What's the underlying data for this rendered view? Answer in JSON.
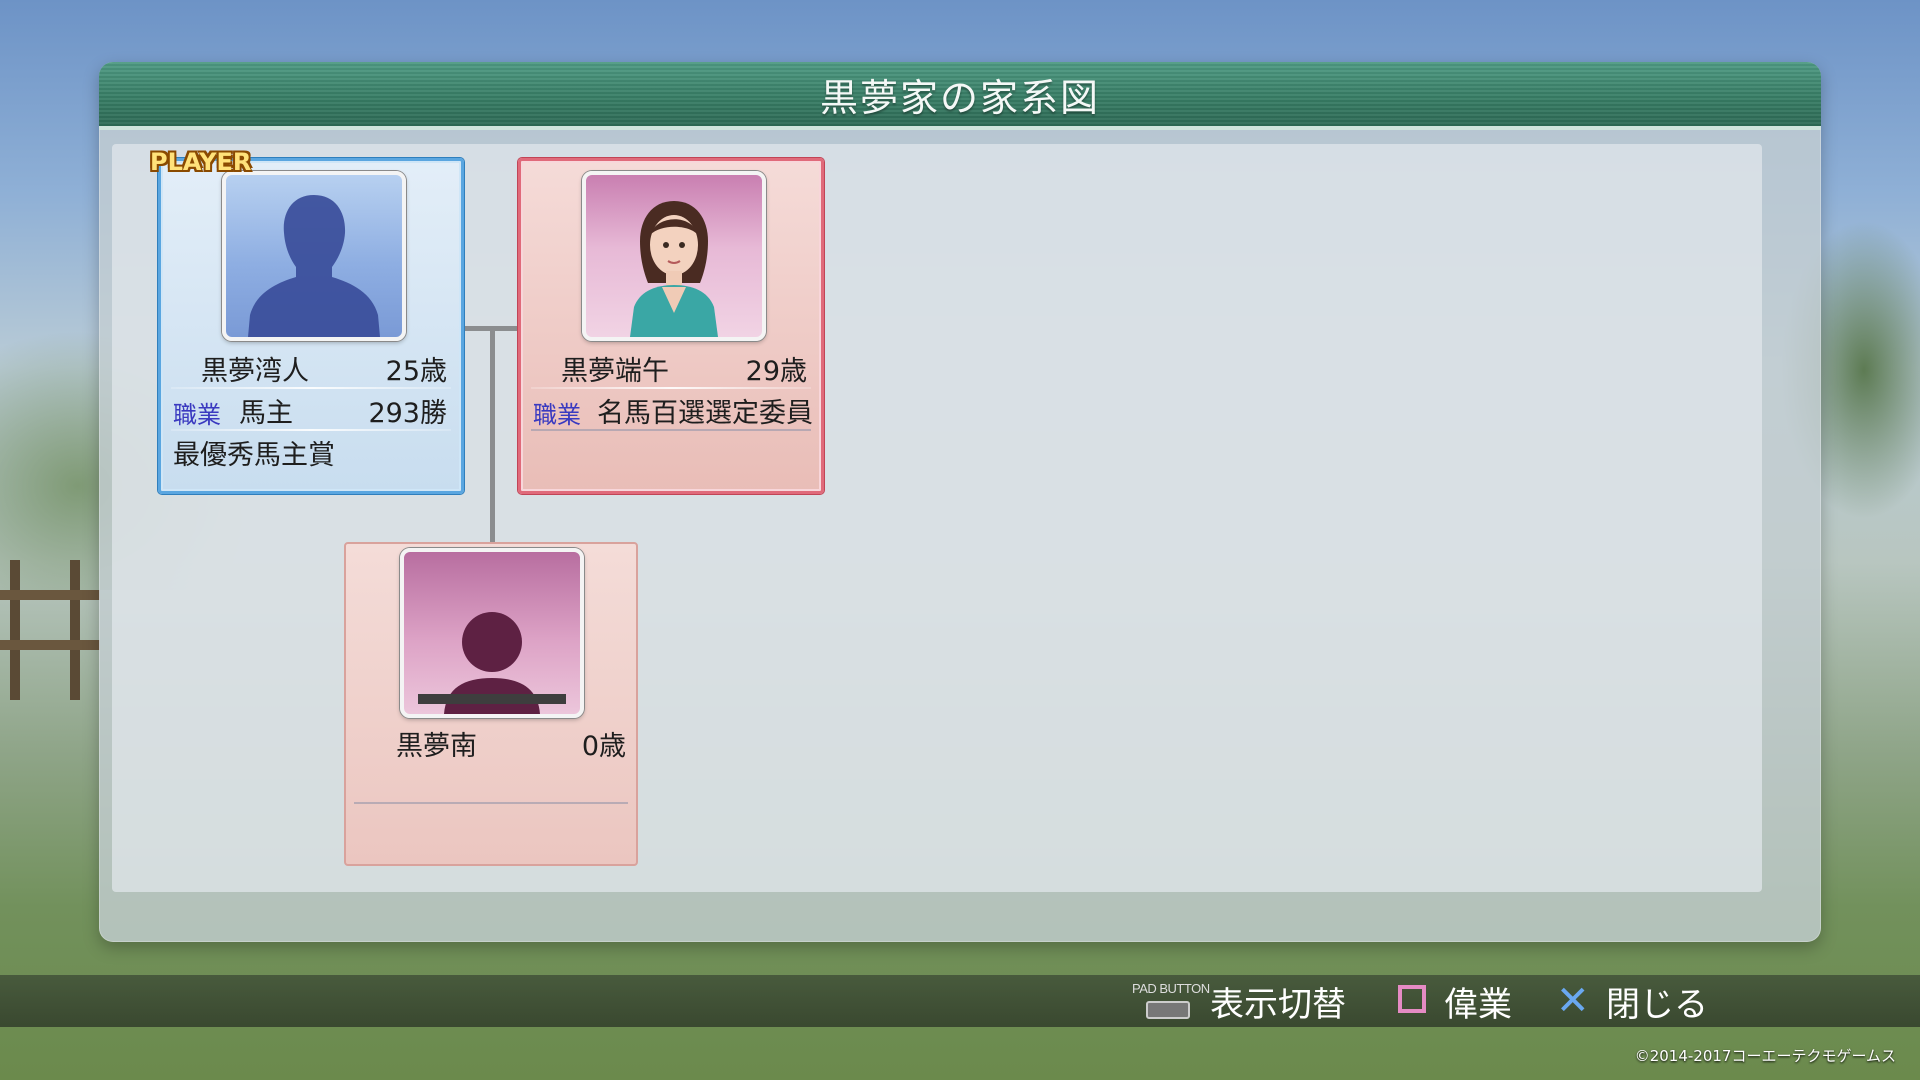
{
  "title": "黒夢家の家系図",
  "player_badge": "PLAYER",
  "father": {
    "name": "黒夢湾人",
    "age": "25歳",
    "job_label": "職業",
    "job": "馬主",
    "wins": "293勝",
    "award": "最優秀馬主賞"
  },
  "mother": {
    "name": "黒夢端午",
    "age": "29歳",
    "job_label": "職業",
    "job": "名馬百選選定委員"
  },
  "child": {
    "name": "黒夢南",
    "age": "0歳"
  },
  "footer": {
    "pad_button_label": "PAD BUTTON",
    "toggle_display": "表示切替",
    "achievements": "偉業",
    "close": "閉じる"
  },
  "copyright": "©2014-2017コーエーテクモゲームス",
  "colors": {
    "header": "#3a8068",
    "player_card_border": "#5aa6e0",
    "spouse_card_border": "#e06a7a",
    "square_button": "#e58bc4",
    "cross_button": "#6aa8f0"
  },
  "icons": {
    "pad": "touchpad-button-icon",
    "square": "square-button-icon",
    "cross": "cross-button-icon"
  }
}
